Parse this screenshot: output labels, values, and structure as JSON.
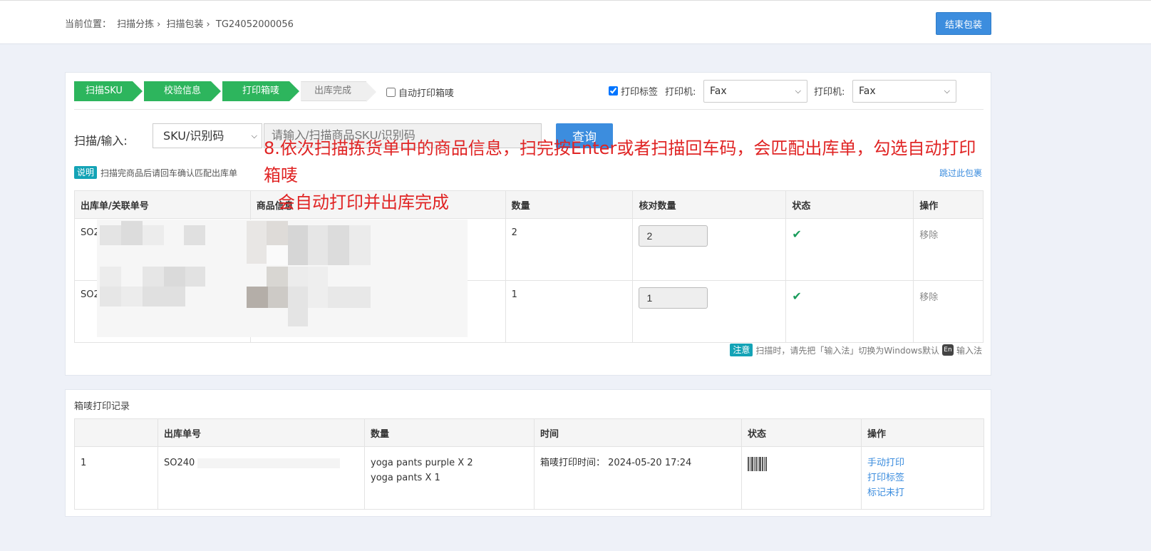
{
  "breadcrumb": {
    "prefix": "当前位置：",
    "items": [
      "扫描分拣",
      "扫描包装",
      "TG24052000056"
    ],
    "sep": "›"
  },
  "header": {
    "end_button": "结束包装"
  },
  "steps": [
    {
      "label": "扫描SKU",
      "state": "done"
    },
    {
      "label": "校验信息",
      "state": "done"
    },
    {
      "label": "打印箱唛",
      "state": "done"
    },
    {
      "label": "出库完成",
      "state": "todo"
    }
  ],
  "colors": {
    "step_done": "#2db55d",
    "primary": "#3c8dde",
    "annotation": "#e02424"
  },
  "options": {
    "auto_print_label": "自动打印箱唛",
    "auto_print_checked": false,
    "print_tag_label": "打印标签",
    "print_tag_checked": true,
    "printer1_label": "打印机:",
    "printer1_value": "Fax",
    "printer2_label": "打印机:",
    "printer2_value": "Fax"
  },
  "scan": {
    "label": "扫描/输入:",
    "type_value": "SKU/识别码",
    "placeholder": "请输入/扫描商品SKU/识别码",
    "query_button": "查询"
  },
  "tip": {
    "badge": "说明",
    "text": "扫描完商品后请回车确认匹配出库单",
    "skip_link": "跳过此包裹"
  },
  "annotation": {
    "line1": "8.依次扫描拣货单中的商品信息，扫完按Enter或者扫描回车码，会匹配出库单，勾选自动打印箱唛",
    "line2": "会自动打印并出库完成"
  },
  "order_table": {
    "headers": [
      "出库单/关联单号",
      "商品信息",
      "数量",
      "核对数量",
      "状态",
      "操作"
    ],
    "rows": [
      {
        "order": "SO2",
        "qty": "2",
        "checked_qty": "2",
        "status_icon": "check-icon",
        "action": "移除"
      },
      {
        "order": "SO2",
        "qty": "1",
        "checked_qty": "1",
        "status_icon": "check-icon",
        "action": "移除"
      }
    ]
  },
  "note": {
    "badge": "注意",
    "text_before": "扫描时，请先把「输入法」切换为Windows默认",
    "icon_text": "En",
    "text_after": "输入法"
  },
  "records": {
    "title": "箱唛打印记录",
    "headers": [
      "",
      "出库单号",
      "数量",
      "时间",
      "状态",
      "操作"
    ],
    "rows": [
      {
        "index": "1",
        "order": "SO240",
        "items": [
          "yoga pants purple X 2",
          "yoga pants X 1"
        ],
        "time_label": "箱唛打印时间：",
        "time_value": "2024-05-20 17:24",
        "status_icon": "barcode-icon",
        "actions": [
          "手动打印",
          "打印标签",
          "标记未打"
        ]
      }
    ]
  }
}
